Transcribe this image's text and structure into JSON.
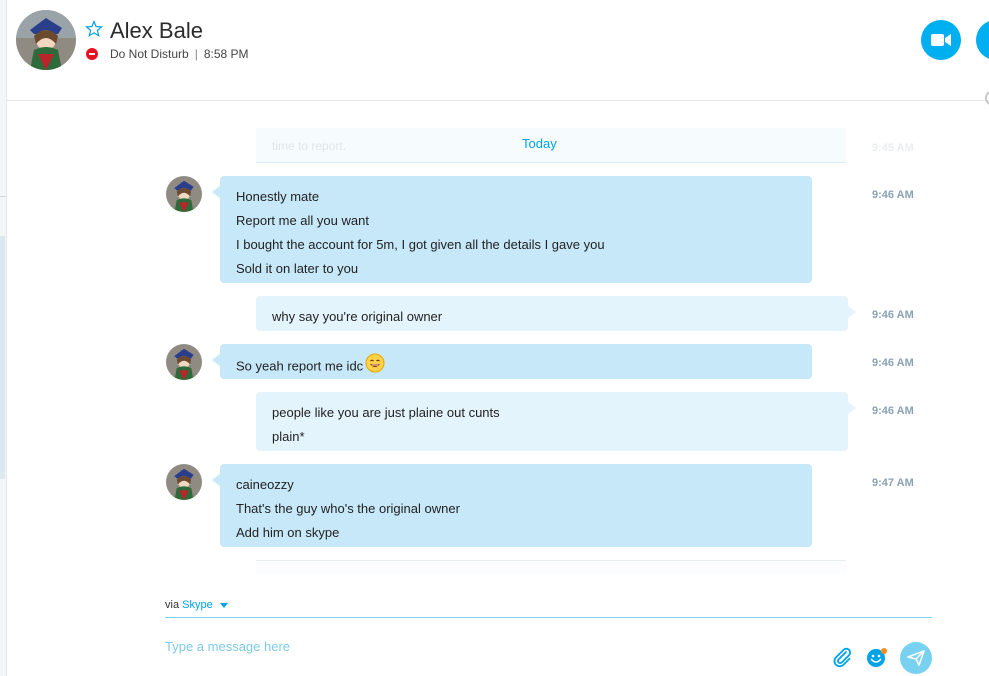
{
  "contact": {
    "name": "Alex Bale",
    "status": "Do Not Disturb",
    "separator": "|",
    "time": "8:58 PM"
  },
  "conversation": {
    "day_label": "Today",
    "faded_message": {
      "text": "time to report.",
      "time": "9:45 AM"
    },
    "messages": [
      {
        "direction": "incoming",
        "lines": [
          "Honestly mate",
          "Report me all you want",
          "I bought the account for 5m, I got given all the details I gave you",
          "Sold it on later to you"
        ],
        "time": "9:46 AM"
      },
      {
        "direction": "outgoing",
        "lines": [
          "why say you're original owner"
        ],
        "time": "9:46 AM"
      },
      {
        "direction": "incoming",
        "lines": [
          "So yeah report me idc"
        ],
        "emoticon": "grin-emoticon",
        "time": "9:46 AM"
      },
      {
        "direction": "outgoing",
        "lines": [
          "people like you are just plaine out cunts",
          "plain*"
        ],
        "time": "9:46 AM"
      },
      {
        "direction": "incoming",
        "lines": [
          "caineozzy",
          "That's the guy who's the original owner",
          "Add him on skype"
        ],
        "time": "9:47 AM"
      }
    ]
  },
  "compose": {
    "via_label": "via",
    "via_link": "Skype",
    "placeholder": "Type a message here"
  },
  "icons": {
    "favorite": "star-outline-icon",
    "status": "do-not-disturb-icon",
    "video": "video-camera-icon",
    "audio": "phone-icon",
    "attach": "paperclip-icon",
    "emoticons": "emoticon-icon",
    "send": "paper-plane-icon"
  },
  "colors": {
    "accent": "#00aff0",
    "incoming_bubble": "#c7e8f9",
    "outgoing_bubble": "#e4f4fc",
    "dnd_red": "#e81123",
    "send_button": "#79d1f2"
  }
}
